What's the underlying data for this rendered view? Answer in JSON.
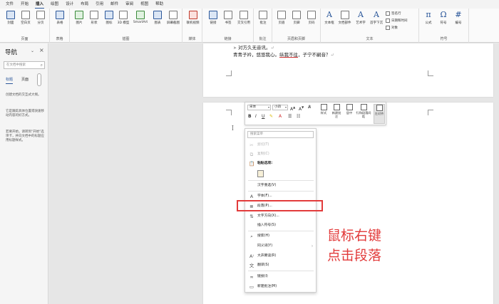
{
  "menubar": {
    "tabs": [
      "文件",
      "开始",
      "插入",
      "绘图",
      "设计",
      "布局",
      "引用",
      "邮件",
      "审阅",
      "视图",
      "帮助"
    ],
    "active_index": 2
  },
  "ribbon": {
    "groups": {
      "pages": {
        "label": "页面",
        "buttons": [
          "封面",
          "空白页",
          "分页"
        ]
      },
      "tables": {
        "label": "表格",
        "buttons": [
          "表格"
        ]
      },
      "illustrations": {
        "label": "插图",
        "buttons": [
          "图片",
          "形状",
          "图标",
          "3D 模型",
          "SmartArt",
          "图表",
          "屏幕截图"
        ]
      },
      "media": {
        "label": "媒体",
        "buttons": [
          "联机视频"
        ]
      },
      "links": {
        "label": "链接",
        "buttons": [
          "链接",
          "书签",
          "交叉引用"
        ]
      },
      "comments": {
        "label": "批注",
        "buttons": [
          "批注"
        ]
      },
      "header_footer": {
        "label": "页眉和页脚",
        "buttons": [
          "页眉",
          "页脚",
          "页码"
        ]
      },
      "text": {
        "label": "文本",
        "buttons": [
          "文本框",
          "文档部件",
          "艺术字",
          "首字下沉"
        ],
        "small": [
          "签名行",
          "日期和时间",
          "对象"
        ]
      },
      "symbols": {
        "label": "符号",
        "buttons": [
          "公式",
          "符号",
          "编号"
        ]
      }
    }
  },
  "navpane": {
    "title": "导航",
    "search_placeholder": "在文档中搜索",
    "tabs": [
      "标题",
      "页面"
    ],
    "paragraphs": [
      "创建文档的交互式大纲。",
      "它是跟踪具体位置或快速移动内容的好方式。",
      "若要开始，请转到\"开始\"选项卡，并向文档中的标题应用标题样式。"
    ]
  },
  "document": {
    "line1": "对方久无音讯。",
    "line2_prefix": "青青子衿，悠悠我心。",
    "line2_underlined": "纵我不往",
    "line2_suffix": "，子宁不嗣音？"
  },
  "minitoolbar": {
    "font_name": "宋体",
    "font_size": "小四",
    "buttons": [
      "样式",
      "新建批注",
      "居中",
      "行和段落间距",
      "左对齐"
    ]
  },
  "contextmenu": {
    "search_placeholder": "搜索菜单",
    "items": {
      "cut": "剪切(T)",
      "copy": "复制(C)",
      "paste_options": "粘贴选项:",
      "hanzi_reconvert": "汉字重选(V)",
      "font": "字体(F)...",
      "paragraph": "段落(P)...",
      "text_direction": "文字方向(X)...",
      "insert_symbol": "插入符号(S)",
      "search": "搜索(H)",
      "synonyms": "同义词(Y)",
      "read_aloud": "大声朗读(R)",
      "translate": "翻译(S)",
      "link": "链接(I)",
      "new_comment": "新建批注(M)"
    }
  },
  "annotation": {
    "line1": "鼠标右键",
    "line2": "点击段落"
  },
  "colors": {
    "accent": "#2b579a",
    "highlight": "#e23b3b"
  }
}
